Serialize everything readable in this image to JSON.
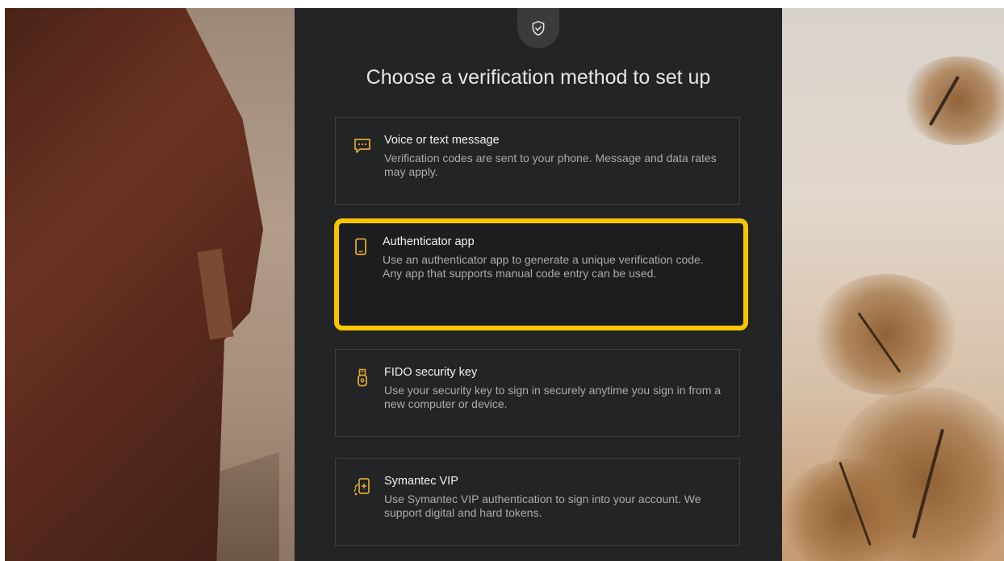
{
  "page": {
    "title": "Choose a verification method to set up"
  },
  "options": [
    {
      "title": "Voice or text message",
      "description": "Verification codes are sent to your phone. Message and data rates may apply.",
      "icon": "message-icon"
    },
    {
      "title": "Authenticator app",
      "description": "Use an authenticator app to generate a unique verification code. Any app that supports manual code entry can be used.",
      "icon": "phone-icon",
      "highlighted": true
    },
    {
      "title": "FIDO security key",
      "description": "Use your security key to sign in securely anytime you sign in from a new computer or device.",
      "icon": "usb-key-icon"
    },
    {
      "title": "Symantec VIP",
      "description": "Use Symantec VIP authentication to sign into your account. We support digital and hard tokens.",
      "icon": "tap-device-icon"
    }
  ],
  "colors": {
    "accent": "#f7c600",
    "icon": "#e0a92b",
    "panel": "#222426",
    "title_text": "#e6e6e6",
    "desc_text": "#a9abae"
  }
}
